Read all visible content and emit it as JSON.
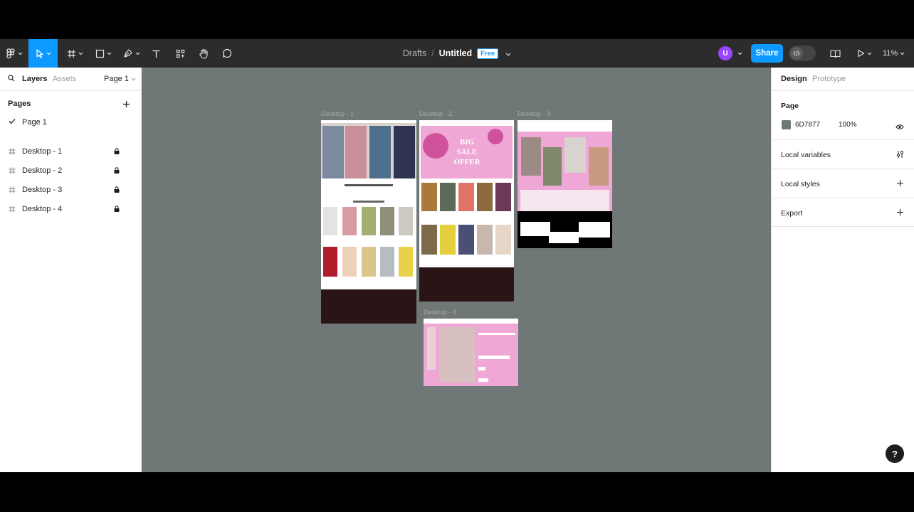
{
  "toolbar": {
    "breadcrumb_drafts": "Drafts",
    "separator": "/",
    "file_title": "Untitled",
    "plan_badge": "Free",
    "avatar_initial": "U",
    "share_label": "Share",
    "zoom": "11%"
  },
  "left_panel": {
    "tab_layers": "Layers",
    "tab_assets": "Assets",
    "page_select": "Page 1",
    "pages_heading": "Pages",
    "pages": [
      {
        "label": "Page 1",
        "selected": true
      }
    ],
    "layers": [
      {
        "label": "Desktop - 1",
        "locked": true
      },
      {
        "label": "Desktop - 2",
        "locked": true
      },
      {
        "label": "Desktop - 3",
        "locked": true
      },
      {
        "label": "Desktop - 4",
        "locked": true
      }
    ]
  },
  "canvas": {
    "background": "#6f7877",
    "frames": [
      {
        "label": "Desktop - 1"
      },
      {
        "label": "Desktop - 2",
        "banner_text": [
          "BIG",
          "SALE",
          "OFFER"
        ]
      },
      {
        "label": "Desktop - 3"
      },
      {
        "label": "Desktop - 4"
      }
    ]
  },
  "right_panel": {
    "tab_design": "Design",
    "tab_prototype": "Prototype",
    "page_heading": "Page",
    "page_color_hex": "6D7877",
    "page_color_opacity": "100%",
    "sections": [
      "Local variables",
      "Local styles",
      "Export"
    ],
    "help_label": "?"
  },
  "colors": {
    "accent": "#0d99ff",
    "toolbar_bg": "#2c2c2c",
    "avatar": "#9747ff",
    "pink": "#efa7d6",
    "footer_dark": "#2b1416"
  }
}
